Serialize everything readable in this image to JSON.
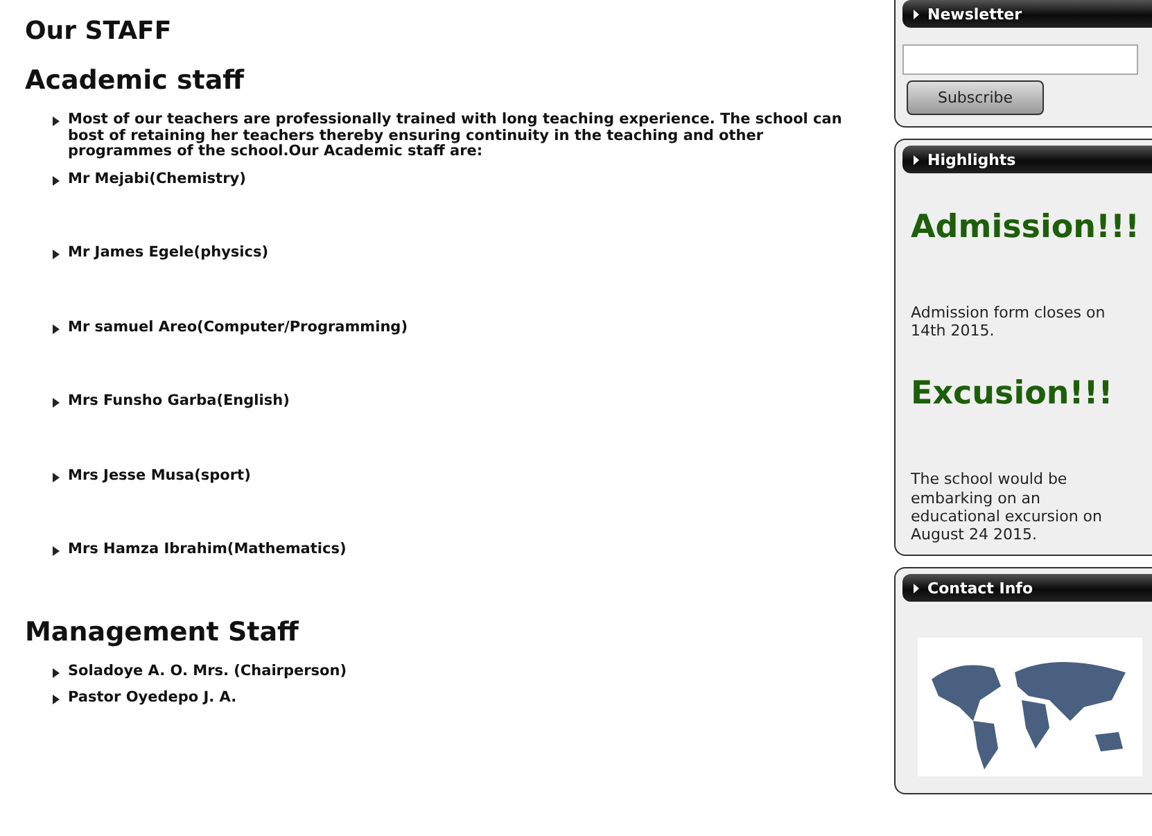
{
  "page_title": "Our STAFF",
  "sections": [
    {
      "heading": "Academic staff",
      "items": [
        "Most of our teachers are professionally trained with long teaching experience. The school can bost of retaining her teachers thereby ensuring continuity in the teaching and other programmes of the school.Our Academic staff are:",
        "Mr Mejabi(Chemistry)",
        "Mr James Egele(physics)",
        "Mr samuel Areo(Computer/Programming)",
        "Mrs Funsho Garba(English)",
        "Mrs Jesse Musa(sport)",
        "Mrs Hamza Ibrahim(Mathematics)"
      ]
    },
    {
      "heading": "Management Staff",
      "items": [
        "Soladoye A. O. Mrs. (Chairperson)",
        "Pastor Oyedepo J. A."
      ]
    }
  ],
  "sidebar": [
    {
      "kind": "newsletter",
      "title": "Newsletter",
      "button": "Subscribe"
    },
    {
      "kind": "highlights",
      "title": "Highlights",
      "news": [
        {
          "headline": "Admission!!!",
          "text": "Admission form closes on 14th 2015."
        },
        {
          "headline": "Excusion!!!",
          "text": "The school would be embarking on an educational excursion on August 24 2015."
        }
      ]
    },
    {
      "kind": "contact",
      "title": "Contact Info"
    }
  ]
}
